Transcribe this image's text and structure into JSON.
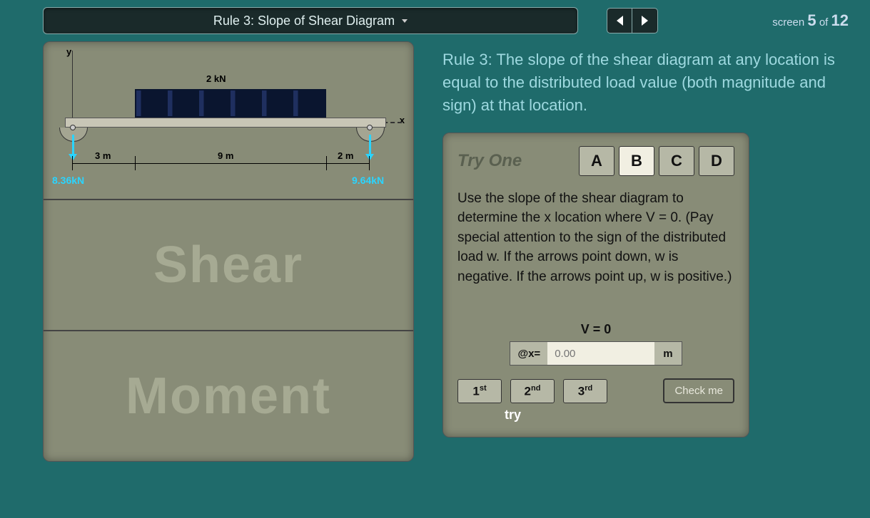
{
  "header": {
    "dropdown_label": "Rule 3: Slope of Shear Diagram",
    "screen_prefix": "screen",
    "screen_current": "5",
    "screen_of": "of",
    "screen_total": "12"
  },
  "diagram": {
    "y_axis": "y",
    "x_axis": "x",
    "load_label": "2 kN",
    "dim1": "3 m",
    "dim2": "9 m",
    "dim3": "2 m",
    "reaction_left": "8.36kN",
    "reaction_right": "9.64kN",
    "shear_label": "Shear",
    "moment_label": "Moment"
  },
  "rule_text": "Rule 3: The slope of the shear diagram at any location is equal to the distributed load value (both magnitude and sign) at that location.",
  "panel": {
    "try_one": "Try One",
    "tabs": {
      "a": "A",
      "b": "B",
      "c": "C",
      "d": "D"
    },
    "prompt": "Use the slope of the shear diagram to determine the x location where V = 0. (Pay special attention to the sign of the distributed load w. If the arrows point down, w is negative. If the arrows point up, w is positive.)",
    "v_zero": "V = 0",
    "at_x": "@x=",
    "x_placeholder": "0.00",
    "unit": "m",
    "try1": "1",
    "try1_suf": "st",
    "try2": "2",
    "try2_suf": "nd",
    "try3": "3",
    "try3_suf": "rd",
    "try_label": "try",
    "check": "Check me"
  }
}
